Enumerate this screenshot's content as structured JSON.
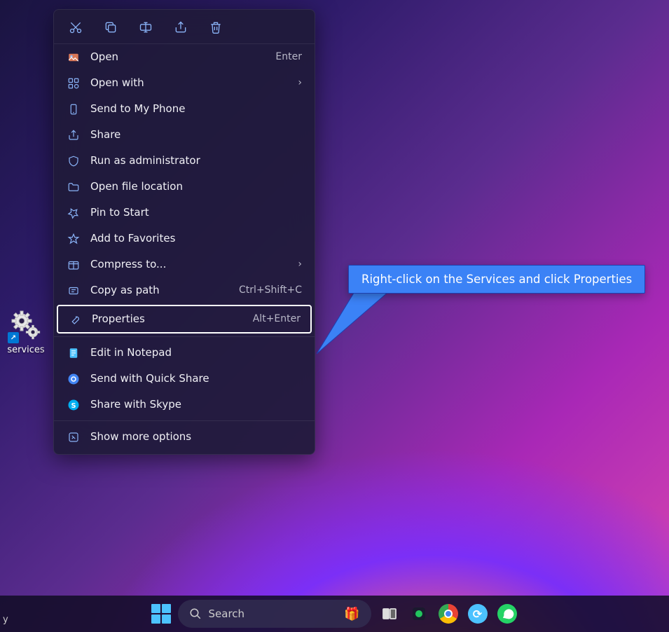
{
  "desktop_icon": {
    "label": "services"
  },
  "context_menu": {
    "toolbar": [
      "cut",
      "copy",
      "rename",
      "share",
      "delete"
    ],
    "items": [
      {
        "id": "open",
        "label": "Open",
        "shortcut": "Enter",
        "icon": "image-icon"
      },
      {
        "id": "open-with",
        "label": "Open with",
        "submenu": true,
        "icon": "open-with-icon"
      },
      {
        "id": "send-phone",
        "label": "Send to My Phone",
        "icon": "phone-icon"
      },
      {
        "id": "share",
        "label": "Share",
        "icon": "share-icon"
      },
      {
        "id": "run-admin",
        "label": "Run as administrator",
        "icon": "shield-icon"
      },
      {
        "id": "open-loc",
        "label": "Open file location",
        "icon": "folder-icon"
      },
      {
        "id": "pin-start",
        "label": "Pin to Start",
        "icon": "pin-icon"
      },
      {
        "id": "add-fav",
        "label": "Add to Favorites",
        "icon": "star-icon"
      },
      {
        "id": "compress",
        "label": "Compress to...",
        "submenu": true,
        "icon": "archive-icon"
      },
      {
        "id": "copy-path",
        "label": "Copy as path",
        "shortcut": "Ctrl+Shift+C",
        "icon": "copy-path-icon"
      },
      {
        "id": "properties",
        "label": "Properties",
        "shortcut": "Alt+Enter",
        "icon": "wrench-icon",
        "highlight": true
      },
      {
        "sep": true
      },
      {
        "id": "edit-notepad",
        "label": "Edit in Notepad",
        "icon": "notepad-icon"
      },
      {
        "id": "quick-share",
        "label": "Send with Quick Share",
        "icon": "quickshare-icon"
      },
      {
        "id": "skype",
        "label": "Share with Skype",
        "icon": "skype-icon"
      },
      {
        "sep": true
      },
      {
        "id": "more",
        "label": "Show more options",
        "icon": "more-icon"
      }
    ]
  },
  "callout": {
    "text": "Right-click on the Services and click Properties"
  },
  "taskbar": {
    "left_text": "y",
    "search_placeholder": "Search",
    "apps": [
      "task-view",
      "app-green",
      "chrome",
      "sync",
      "whatsapp"
    ]
  }
}
